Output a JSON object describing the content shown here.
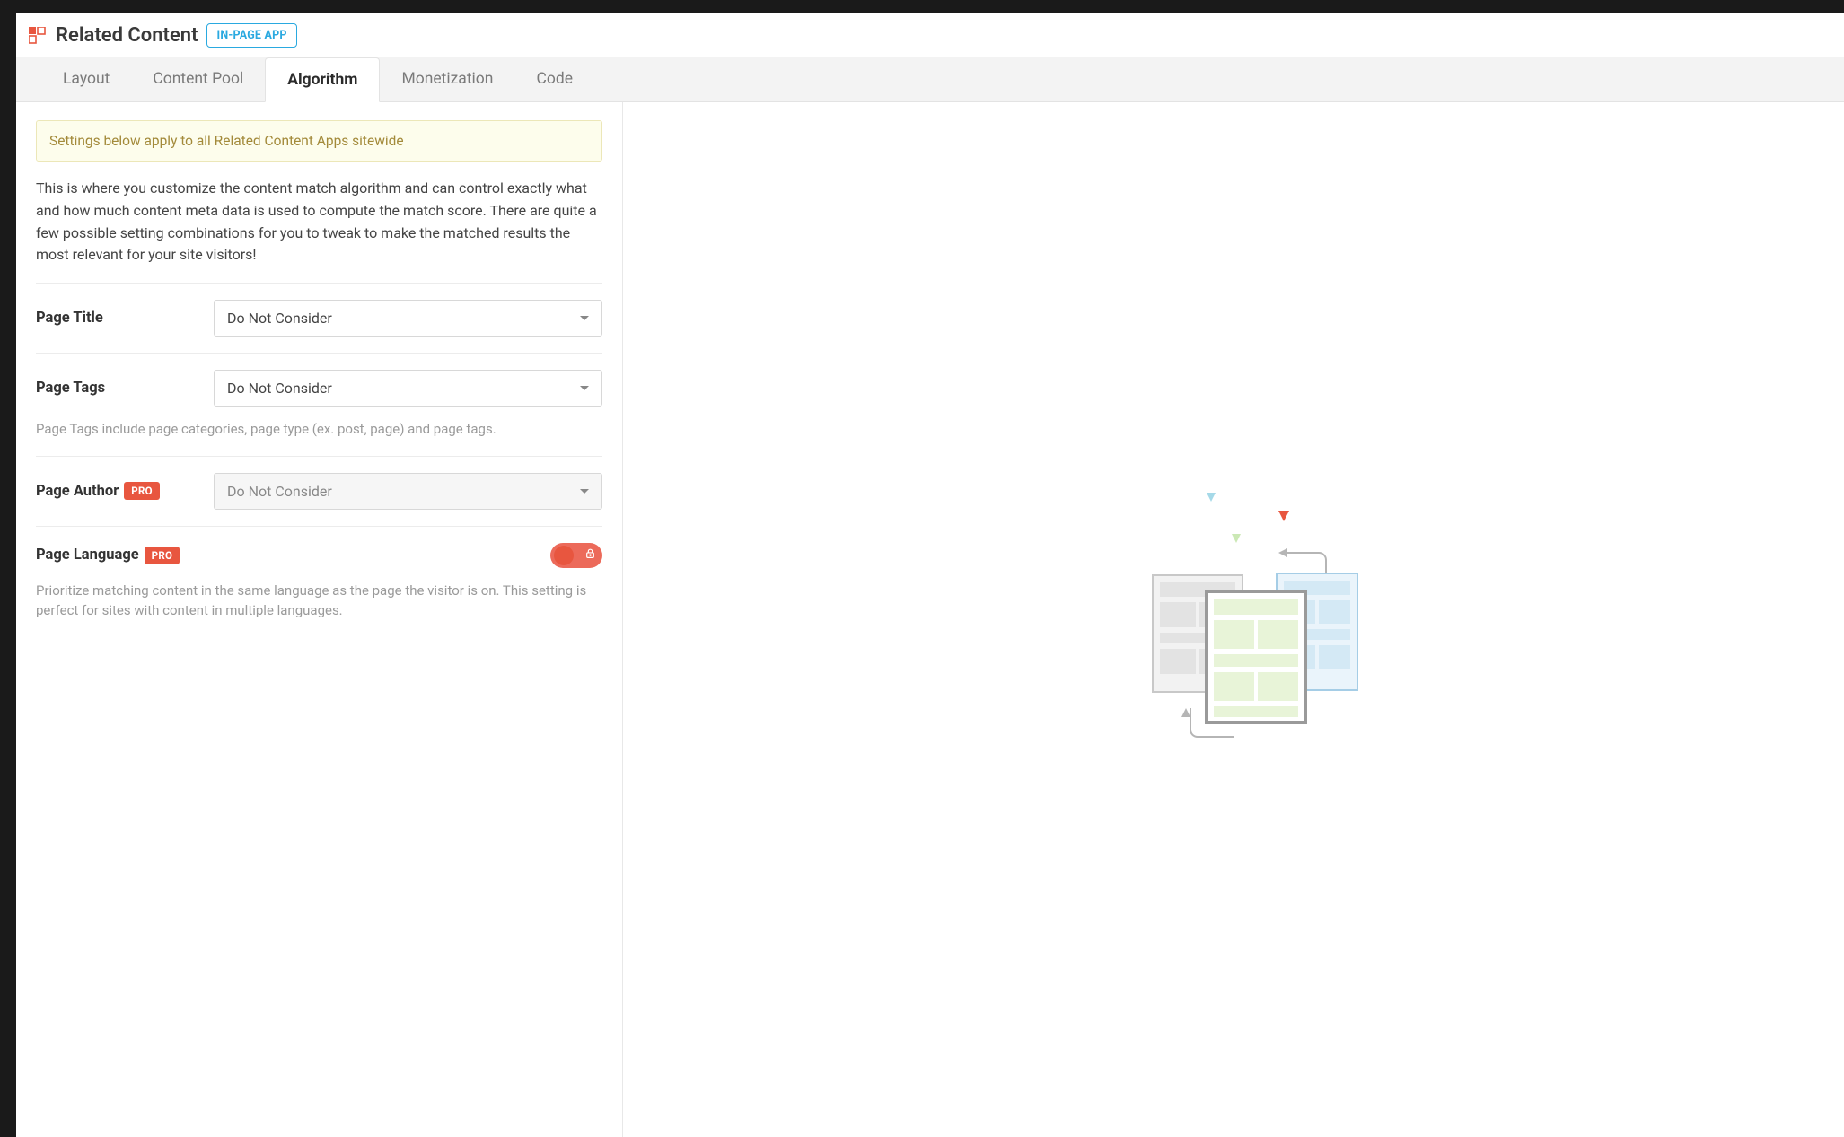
{
  "header": {
    "title": "Related Content",
    "badge": "IN-PAGE APP"
  },
  "tabs": [
    {
      "label": "Layout",
      "active": false
    },
    {
      "label": "Content Pool",
      "active": false
    },
    {
      "label": "Algorithm",
      "active": true
    },
    {
      "label": "Monetization",
      "active": false
    },
    {
      "label": "Code",
      "active": false
    }
  ],
  "notice": "Settings below apply to all Related Content Apps sitewide",
  "intro": "This is where you customize the content match algorithm and can control exactly what and how much content meta data is used to compute the match score. There are quite a few possible setting combinations for you to tweak to make the matched results the most relevant for your site visitors!",
  "sections": {
    "page_title": {
      "label": "Page Title",
      "value": "Do Not Consider"
    },
    "page_tags": {
      "label": "Page Tags",
      "value": "Do Not Consider",
      "helper": "Page Tags include page categories, page type (ex. post, page) and page tags."
    },
    "page_author": {
      "label": "Page Author",
      "pro": "PRO",
      "value": "Do Not Consider"
    },
    "page_language": {
      "label": "Page Language",
      "pro": "PRO",
      "helper": "Prioritize matching content in the same language as the page the visitor is on. This setting is perfect for sites with content in multiple languages."
    }
  }
}
